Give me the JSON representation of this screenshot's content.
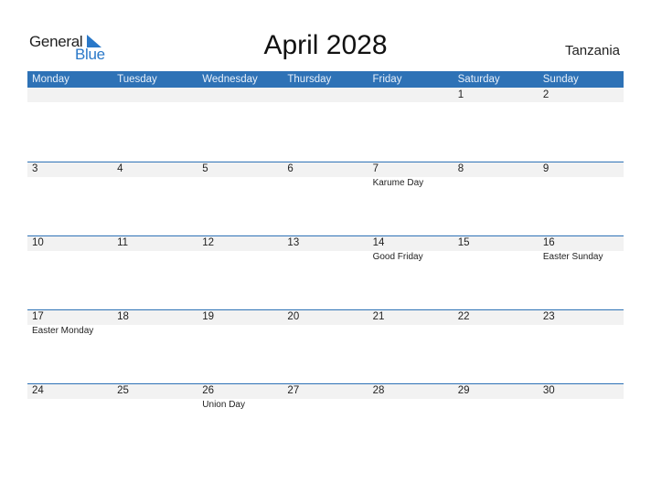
{
  "logo": {
    "general": "General",
    "blue": "Blue"
  },
  "title": "April 2028",
  "country": "Tanzania",
  "weekdays": [
    "Monday",
    "Tuesday",
    "Wednesday",
    "Thursday",
    "Friday",
    "Saturday",
    "Sunday"
  ],
  "weeks": [
    [
      {
        "day": ""
      },
      {
        "day": ""
      },
      {
        "day": ""
      },
      {
        "day": ""
      },
      {
        "day": ""
      },
      {
        "day": "1"
      },
      {
        "day": "2"
      }
    ],
    [
      {
        "day": "3"
      },
      {
        "day": "4"
      },
      {
        "day": "5"
      },
      {
        "day": "6"
      },
      {
        "day": "7",
        "holiday": "Karume Day"
      },
      {
        "day": "8"
      },
      {
        "day": "9"
      }
    ],
    [
      {
        "day": "10"
      },
      {
        "day": "11"
      },
      {
        "day": "12"
      },
      {
        "day": "13"
      },
      {
        "day": "14",
        "holiday": "Good Friday"
      },
      {
        "day": "15"
      },
      {
        "day": "16",
        "holiday": "Easter Sunday"
      }
    ],
    [
      {
        "day": "17",
        "holiday": "Easter Monday"
      },
      {
        "day": "18"
      },
      {
        "day": "19"
      },
      {
        "day": "20"
      },
      {
        "day": "21"
      },
      {
        "day": "22"
      },
      {
        "day": "23"
      }
    ],
    [
      {
        "day": "24"
      },
      {
        "day": "25"
      },
      {
        "day": "26",
        "holiday": "Union Day"
      },
      {
        "day": "27"
      },
      {
        "day": "28"
      },
      {
        "day": "29"
      },
      {
        "day": "30"
      }
    ]
  ],
  "colors": {
    "accent": "#2e72b6",
    "logo_blue": "#2a78c8",
    "band": "#f2f2f2"
  }
}
